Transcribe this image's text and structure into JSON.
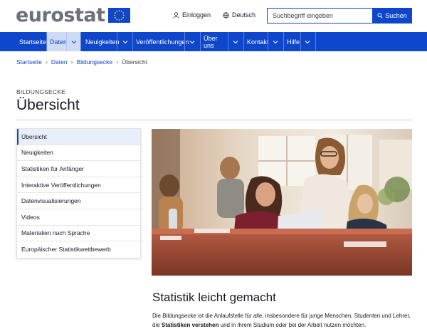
{
  "header": {
    "logo_text": "eurostat",
    "login_label": "Einloggen",
    "language_label": "Deutsch",
    "search_placeholder": "Suchbegriff eingeben",
    "search_button_label": "Suchen"
  },
  "nav": {
    "items": [
      {
        "label": "Startseite"
      },
      {
        "label": "Daten"
      },
      {
        "label": "Neuigkeiten"
      },
      {
        "label": "Veröffentlichungen"
      },
      {
        "label": "Über uns"
      },
      {
        "label": "Kontakt"
      },
      {
        "label": "Hilfe"
      }
    ]
  },
  "breadcrumb": {
    "items": [
      "Startseite",
      "Daten",
      "Bildungsecke"
    ],
    "current": "Übersicht"
  },
  "page": {
    "kicker": "BILDUNGSECKE",
    "title": "Übersicht"
  },
  "sidemenu": {
    "items": [
      "Übersicht",
      "Neuigkeiten",
      "Statistiken für Anfänger",
      "Interaktive Veröffentlichungen",
      "Datenvisualisierungen",
      "Videos",
      "Materialien nach Sprache",
      "Europäischer Statistikwettbewerb"
    ]
  },
  "section": {
    "title": "Statistik leicht gemacht",
    "text_part1": "Die Bildungsecke ist die Anlaufstelle für alle, insbesondere für junge Menschen, Studenten und Lehrer,",
    "text_part2": "die ",
    "text_bold": "Statistiken verstehen",
    "text_part3": " und in ihrem Studium oder bei der Arbeit nutzen möchten."
  },
  "colors": {
    "brand_blue": "#0e47cb",
    "nav_active_bg": "#cfdaf5",
    "logo_gray": "#6b7079"
  }
}
